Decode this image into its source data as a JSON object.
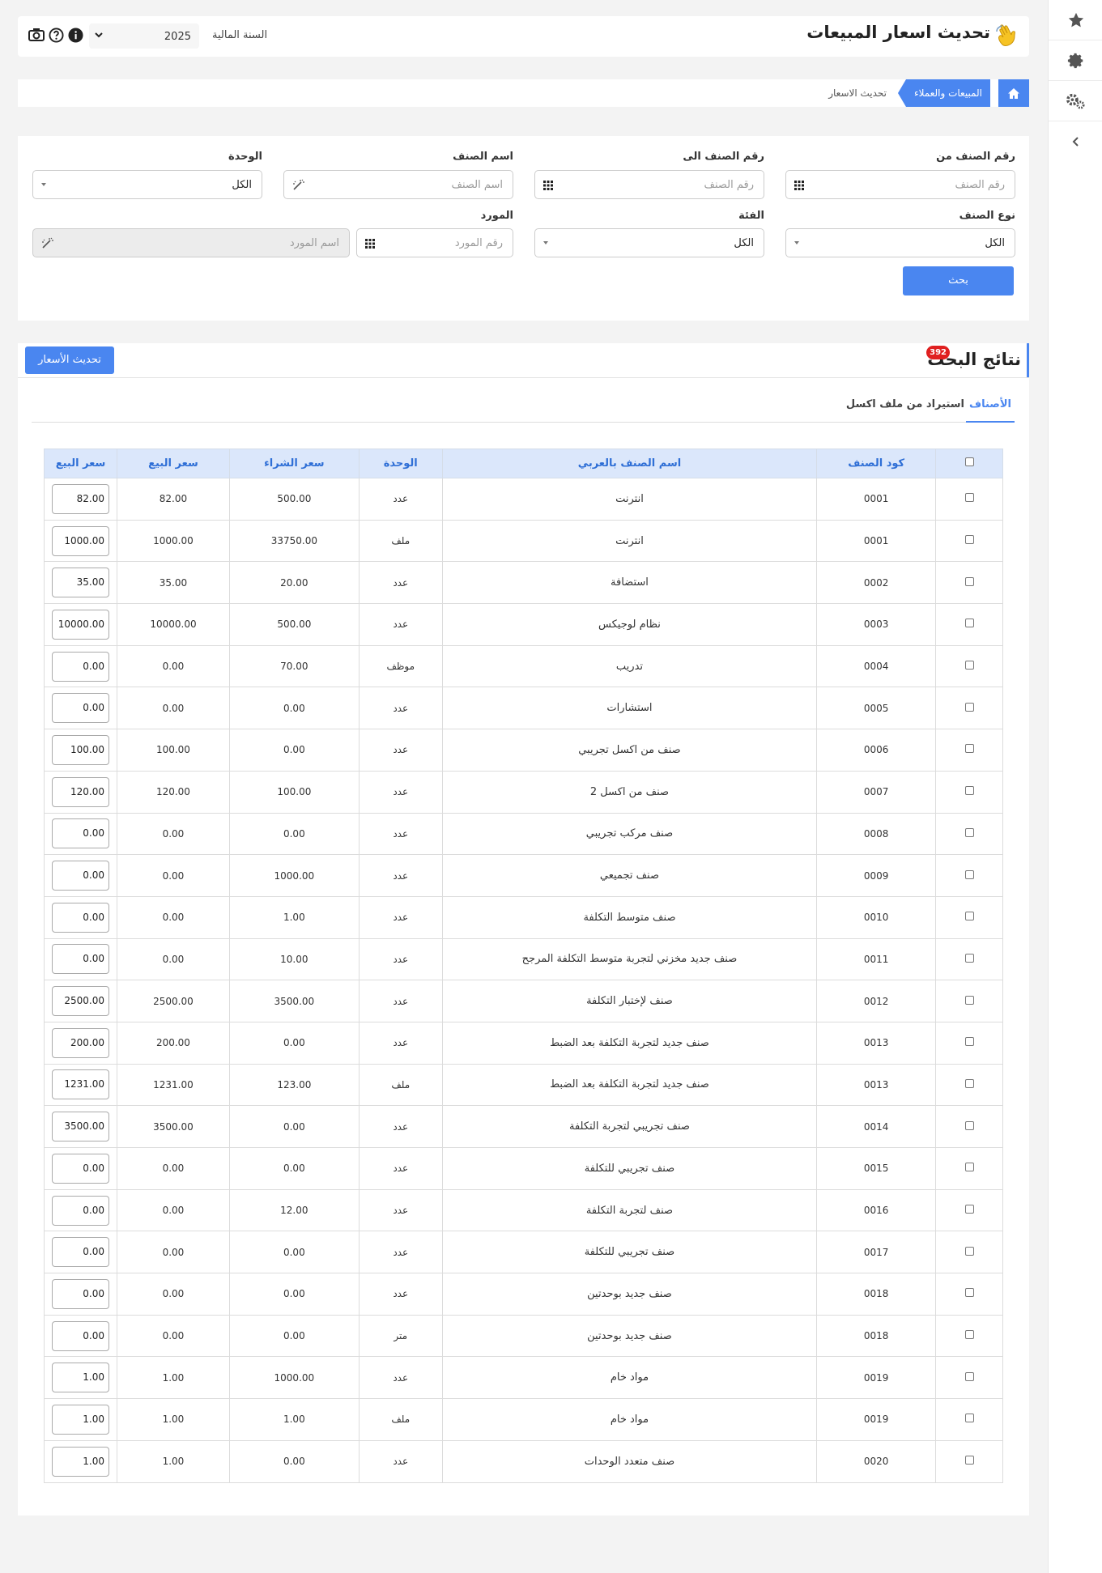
{
  "header": {
    "title": "تحديث اسعار المبيعات",
    "fiscal_year_label": "السنة المالية",
    "fiscal_year_value": "2025"
  },
  "breadcrumb": {
    "section": "المبيعات والعملاء",
    "current": "تحديث الاسعار"
  },
  "filters": {
    "item_from": {
      "label": "رقم الصنف من",
      "placeholder": "رقم الصنف"
    },
    "item_to": {
      "label": "رقم الصنف الى",
      "placeholder": "رقم الصنف"
    },
    "item_name": {
      "label": "اسم الصنف",
      "placeholder": "اسم الصنف"
    },
    "unit": {
      "label": "الوحدة",
      "value": "الكل"
    },
    "item_type": {
      "label": "نوع الصنف",
      "value": "الكل"
    },
    "category": {
      "label": "الفئة",
      "value": "الكل"
    },
    "supplier": {
      "label": "المورد",
      "placeholder": "رقم المورد",
      "name_placeholder": "اسم المورد"
    },
    "search_button": "بحث"
  },
  "results": {
    "title": "نتائج البحث",
    "count": "392",
    "update_button": "تحديث الأسعار",
    "tabs": [
      "الأصناف",
      "استيراد من ملف اكسل"
    ],
    "columns": [
      "كود الصنف",
      "اسم الصنف بالعربي",
      "الوحدة",
      "سعر الشراء",
      "سعر البيع",
      "سعر البيع"
    ],
    "rows": [
      {
        "code": "0001",
        "name": "انترنت",
        "unit": "عدد",
        "buy": "500.00",
        "sell": "82.00",
        "new_sell": "82.00"
      },
      {
        "code": "0001",
        "name": "انترنت",
        "unit": "ملف",
        "buy": "33750.00",
        "sell": "1000.00",
        "new_sell": "1000.00"
      },
      {
        "code": "0002",
        "name": "استضافة",
        "unit": "عدد",
        "buy": "20.00",
        "sell": "35.00",
        "new_sell": "35.00"
      },
      {
        "code": "0003",
        "name": "نظام لوجيكس",
        "unit": "عدد",
        "buy": "500.00",
        "sell": "10000.00",
        "new_sell": "10000.00"
      },
      {
        "code": "0004",
        "name": "تدريب",
        "unit": "موظف",
        "buy": "70.00",
        "sell": "0.00",
        "new_sell": "0.00"
      },
      {
        "code": "0005",
        "name": "استشارات",
        "unit": "عدد",
        "buy": "0.00",
        "sell": "0.00",
        "new_sell": "0.00"
      },
      {
        "code": "0006",
        "name": "صنف من اكسل تجريبي",
        "unit": "عدد",
        "buy": "0.00",
        "sell": "100.00",
        "new_sell": "100.00"
      },
      {
        "code": "0007",
        "name": "صنف من اكسل 2",
        "unit": "عدد",
        "buy": "100.00",
        "sell": "120.00",
        "new_sell": "120.00"
      },
      {
        "code": "0008",
        "name": "صنف مركب تجريبي",
        "unit": "عدد",
        "buy": "0.00",
        "sell": "0.00",
        "new_sell": "0.00"
      },
      {
        "code": "0009",
        "name": "صنف تجميعي",
        "unit": "عدد",
        "buy": "1000.00",
        "sell": "0.00",
        "new_sell": "0.00"
      },
      {
        "code": "0010",
        "name": "صنف متوسط التكلفة",
        "unit": "عدد",
        "buy": "1.00",
        "sell": "0.00",
        "new_sell": "0.00"
      },
      {
        "code": "0011",
        "name": "صنف جديد مخزني لتجربة متوسط التكلفة المرجح",
        "unit": "عدد",
        "buy": "10.00",
        "sell": "0.00",
        "new_sell": "0.00"
      },
      {
        "code": "0012",
        "name": "صنف لإختبار التكلفة",
        "unit": "عدد",
        "buy": "3500.00",
        "sell": "2500.00",
        "new_sell": "2500.00"
      },
      {
        "code": "0013",
        "name": "صنف جديد لتجربة التكلفة بعد الضبط",
        "unit": "عدد",
        "buy": "0.00",
        "sell": "200.00",
        "new_sell": "200.00"
      },
      {
        "code": "0013",
        "name": "صنف جديد لتجربة التكلفة بعد الضبط",
        "unit": "ملف",
        "buy": "123.00",
        "sell": "1231.00",
        "new_sell": "1231.00"
      },
      {
        "code": "0014",
        "name": "صنف تجريبي لتجربة التكلفة",
        "unit": "عدد",
        "buy": "0.00",
        "sell": "3500.00",
        "new_sell": "3500.00"
      },
      {
        "code": "0015",
        "name": "صنف تجريبي للتكلفة",
        "unit": "عدد",
        "buy": "0.00",
        "sell": "0.00",
        "new_sell": "0.00"
      },
      {
        "code": "0016",
        "name": "صنف لتجربة التكلفة",
        "unit": "عدد",
        "buy": "12.00",
        "sell": "0.00",
        "new_sell": "0.00"
      },
      {
        "code": "0017",
        "name": "صنف تجريبي للتكلفة",
        "unit": "عدد",
        "buy": "0.00",
        "sell": "0.00",
        "new_sell": "0.00"
      },
      {
        "code": "0018",
        "name": "صنف جديد بوحدتين",
        "unit": "عدد",
        "buy": "0.00",
        "sell": "0.00",
        "new_sell": "0.00"
      },
      {
        "code": "0018",
        "name": "صنف جديد بوحدتين",
        "unit": "متر",
        "buy": "0.00",
        "sell": "0.00",
        "new_sell": "0.00"
      },
      {
        "code": "0019",
        "name": "مواد خام",
        "unit": "عدد",
        "buy": "1000.00",
        "sell": "1.00",
        "new_sell": "1.00"
      },
      {
        "code": "0019",
        "name": "مواد خام",
        "unit": "ملف",
        "buy": "1.00",
        "sell": "1.00",
        "new_sell": "1.00"
      },
      {
        "code": "0020",
        "name": "صنف متعدد الوحدات",
        "unit": "عدد",
        "buy": "0.00",
        "sell": "1.00",
        "new_sell": "1.00"
      }
    ]
  },
  "colors": {
    "accent": "#4a86f0",
    "badge": "#e02020",
    "table_header_bg": "#dbe7fb"
  },
  "icons": [
    "star-icon",
    "gear-icon",
    "gears-icon",
    "chevron-left-icon",
    "camera-icon",
    "help-icon",
    "info-icon",
    "wave-hand-icon",
    "home-icon",
    "grid-icon",
    "wand-icon"
  ]
}
